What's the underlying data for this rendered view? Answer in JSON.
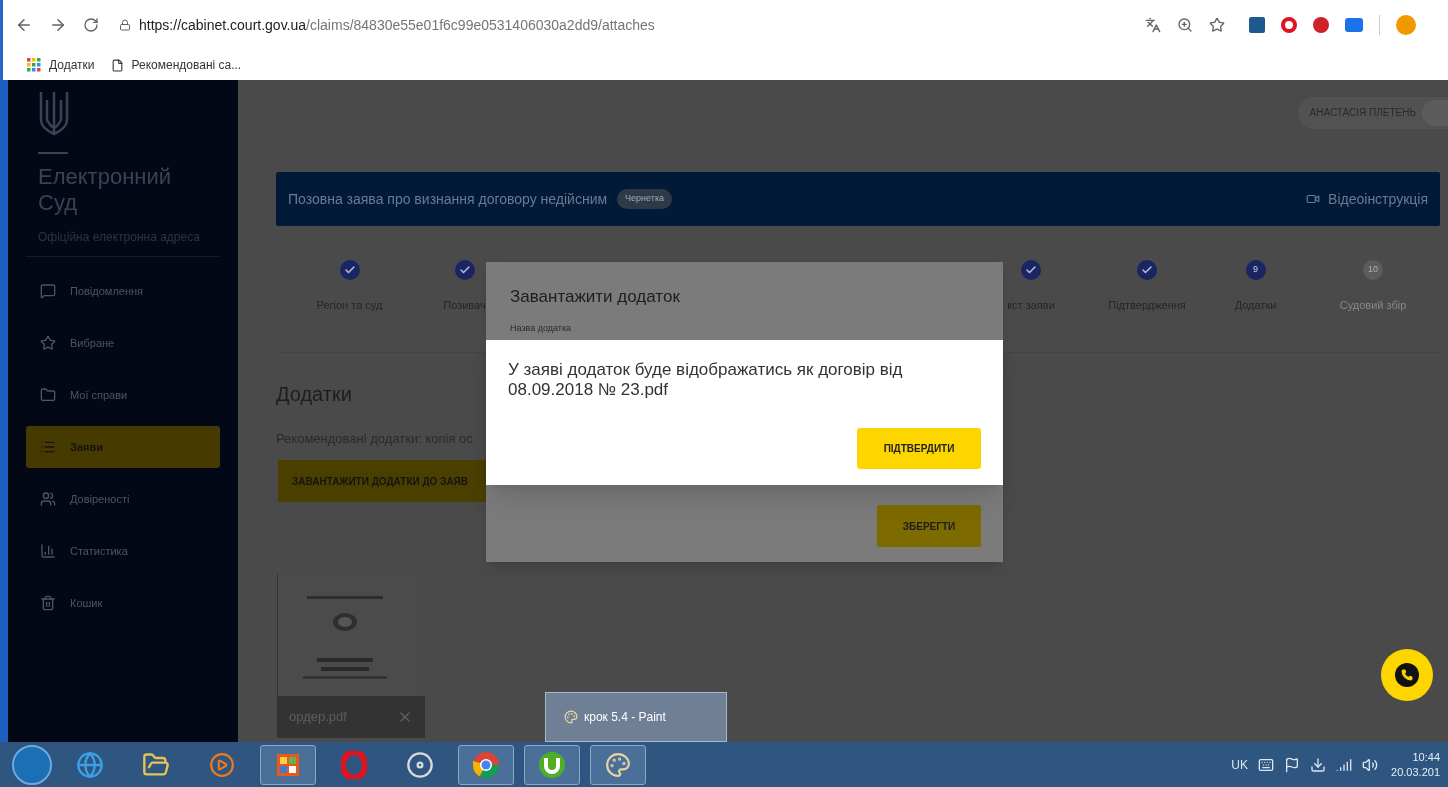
{
  "browser": {
    "url_domain": "https://cabinet.court.gov.ua",
    "url_path": "/claims/84830e55e01f6c99e0531406030a2dd9/attaches",
    "bookmarks": [
      {
        "kind": "apps",
        "label": "Додатки"
      },
      {
        "kind": "page",
        "label": "Рекомендовані са..."
      }
    ]
  },
  "sidebar": {
    "title": "Електронний Суд",
    "subtitle": "Офіційна електронна адреса",
    "items": [
      {
        "label": "Повідомлення",
        "selected": false
      },
      {
        "label": "Вибране",
        "selected": false
      },
      {
        "label": "Мої справи",
        "selected": false
      },
      {
        "label": "Заяви",
        "selected": true
      },
      {
        "label": "Довіреності",
        "selected": false
      },
      {
        "label": "Статистика",
        "selected": false
      },
      {
        "label": "Кошик",
        "selected": false
      }
    ]
  },
  "header": {
    "user": "АНАСТАСІЯ ПЛЕТЕНЬ"
  },
  "banner": {
    "title": "Позовна заява про визнання договору недійсним",
    "badge": "Чернетка",
    "video_link": "Відеоінструкція"
  },
  "steps_start": [
    {
      "kind": "done",
      "label": "Регіон та суд"
    },
    {
      "kind": "done",
      "label": "Позивач"
    }
  ],
  "steps_end": [
    {
      "kind": "done",
      "label": "кст заяви"
    },
    {
      "kind": "done",
      "label": "Підтвердження"
    },
    {
      "kind": "current",
      "number": "9",
      "label": "Додатки"
    },
    {
      "kind": "upcoming",
      "number": "10",
      "label": "Судовий збір"
    }
  ],
  "section": {
    "heading": "Додатки",
    "recommended": "Рекомендовані додатки: копія ос",
    "upload_button": "ЗАВАНТАЖИТИ ДОДАТКИ ДО ЗАЯВ"
  },
  "attachment": {
    "file_name": "ордер.pdf"
  },
  "upload_dialog": {
    "title": "Завантажити додаток",
    "field_label": "Назва додатка",
    "save_button": "ЗБЕРЕГТИ"
  },
  "confirm_dialog": {
    "message": "У заяві додаток буде відображатись як договір від 08.09.2018 № 23.pdf",
    "confirm_button": "ПІДТВЕРДИТИ"
  },
  "taskbar": {
    "apps": [
      {
        "kind": "ie",
        "running": false
      },
      {
        "kind": "explorer",
        "running": false
      },
      {
        "kind": "media",
        "running": false
      },
      {
        "kind": "tool",
        "running": true
      },
      {
        "kind": "opera",
        "running": false
      },
      {
        "kind": "reel",
        "running": false
      },
      {
        "kind": "chrome",
        "running": true
      },
      {
        "kind": "torrent",
        "running": true
      },
      {
        "kind": "paint",
        "running": true
      }
    ],
    "preview": "крок 5.4 - Paint",
    "language": "UK",
    "time": "10:44",
    "date": "20.03.201"
  }
}
